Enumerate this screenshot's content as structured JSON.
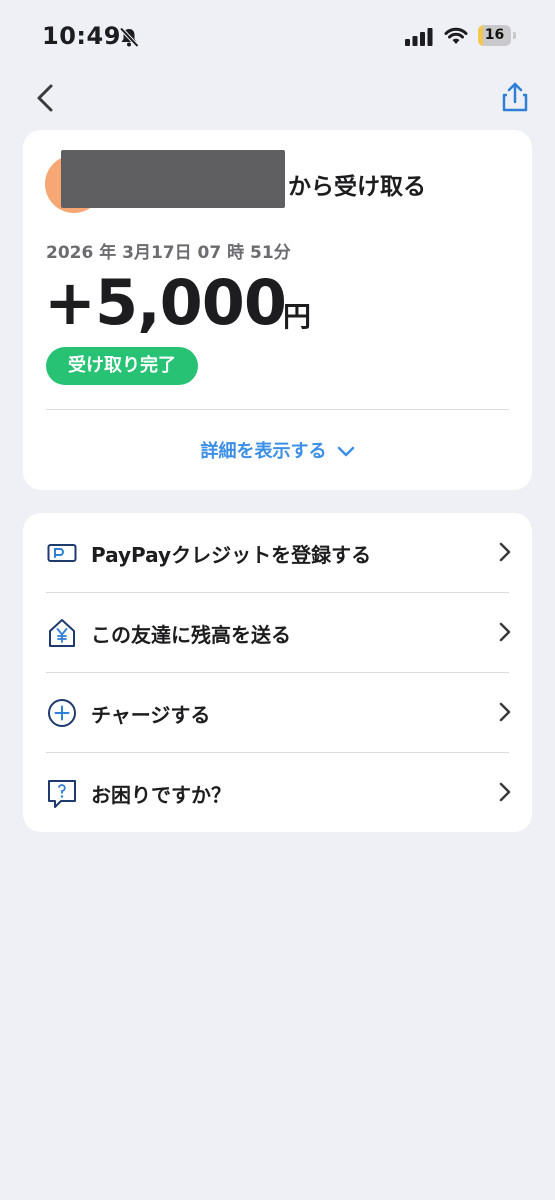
{
  "status_bar": {
    "time": "10:49",
    "battery": "16",
    "battery_level": 0.16,
    "icons": [
      "bell-slash-icon",
      "cellular-signal-icon",
      "wifi-icon",
      "battery-icon"
    ]
  },
  "nav": {
    "back_icon": "chevron-left-icon",
    "share_icon": "share-icon"
  },
  "transaction": {
    "from_suffix": "から受け取る",
    "date": "2026 年 3月17日 07 時 51分",
    "amount": "+5,000",
    "currency": "円",
    "status": "受け取り完了",
    "details_link": "詳細を表示する"
  },
  "menu": {
    "items": [
      {
        "label": "PayPayクレジットを登録する",
        "icon": "credit-card-icon"
      },
      {
        "label": "この友達に残高を送る",
        "icon": "yen-house-icon"
      },
      {
        "label": "チャージする",
        "icon": "plus-circle-icon"
      },
      {
        "label": "お困りですか？",
        "icon": "help-chat-icon"
      }
    ]
  },
  "colors": {
    "background": "#eff0f5",
    "card": "#ffffff",
    "status_green": "#27c274",
    "link_blue": "#3c8fe6",
    "icon_navy": "#1f3a6e",
    "avatar_orange": "#f6a774",
    "battery_yellow": "#f2c94c"
  }
}
